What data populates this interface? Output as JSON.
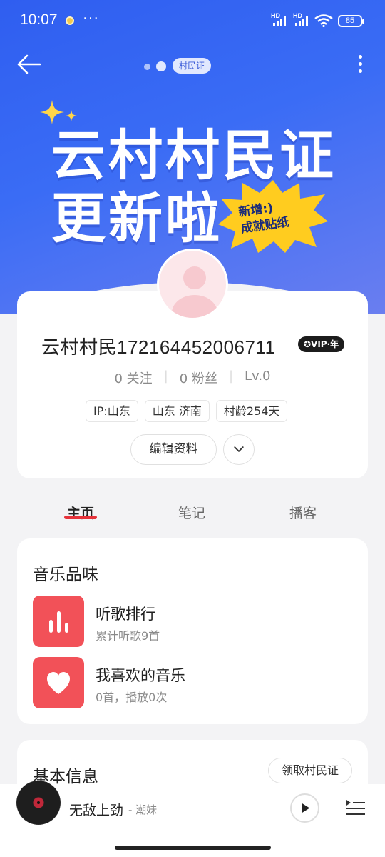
{
  "status_bar": {
    "time": "10:07",
    "dots": "···",
    "hd1": "HD",
    "hd2": "HD",
    "battery": "85"
  },
  "header": {
    "tag": "村民证"
  },
  "banner": {
    "line1": "云村村民证",
    "line2": "更新啦",
    "burst_line1": "新增:)",
    "burst_line2": "成就贴纸"
  },
  "profile": {
    "name": "云村村民1721644520067​11",
    "vip_badge": "✪VIP·年",
    "following": "0 关注",
    "followers": "0 粉丝",
    "level": "Lv.0",
    "chips": [
      "IP:山东",
      "山东 济南",
      "村龄254天"
    ],
    "edit_label": "编辑资料"
  },
  "tabs": [
    {
      "label": "主页",
      "active": true
    },
    {
      "label": "笔记",
      "active": false
    },
    {
      "label": "播客",
      "active": false
    }
  ],
  "music_taste": {
    "title": "音乐品味",
    "items": [
      {
        "title": "听歌排行",
        "subtitle": "累计听歌9首",
        "icon": "bar-chart-icon"
      },
      {
        "title": "我喜欢的音乐",
        "subtitle": "0首，播放0次",
        "icon": "heart-icon"
      }
    ]
  },
  "basic_info": {
    "title": "基本信息",
    "claim_label": "领取村民证"
  },
  "player": {
    "song": "无敌上劲",
    "artist": "- 潮妹"
  },
  "colors": {
    "banner": "#3a6cf5",
    "accent_red": "#f25158",
    "tab_underline": "#e6323a"
  }
}
